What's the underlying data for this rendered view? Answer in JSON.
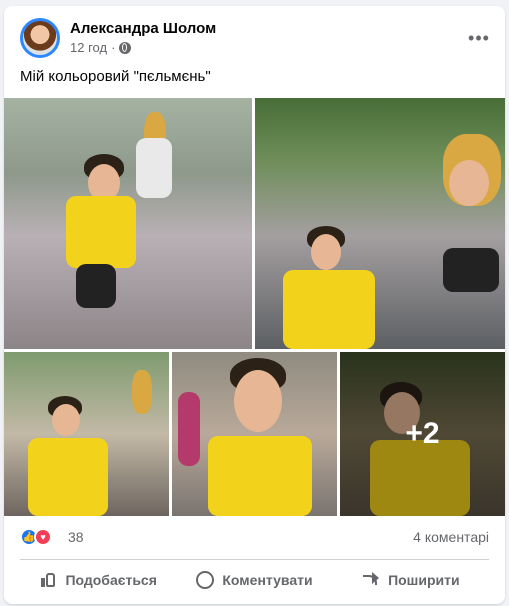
{
  "post": {
    "author": "Александра Шолом",
    "time": "12 год",
    "privacy_icon": "globe-icon",
    "text": "Мій кольоровий \"пєльмєнь\"",
    "more_icon": "more-options-icon",
    "more_label": "•••"
  },
  "photos": {
    "items": [
      "photo-1",
      "photo-2",
      "photo-3",
      "photo-4",
      "photo-5"
    ],
    "more_count": "+2"
  },
  "reactions": {
    "types": [
      "like",
      "love"
    ],
    "like_glyph": "👍",
    "love_glyph": "♥",
    "count": "38",
    "comments": "4 коментарі"
  },
  "actions": {
    "like_label": "Подобається",
    "comment_label": "Коментувати",
    "share_label": "Поширити"
  },
  "colors": {
    "accent": "#1877f2",
    "love": "#f33e58",
    "muted_text": "#65676b",
    "text": "#050505"
  }
}
